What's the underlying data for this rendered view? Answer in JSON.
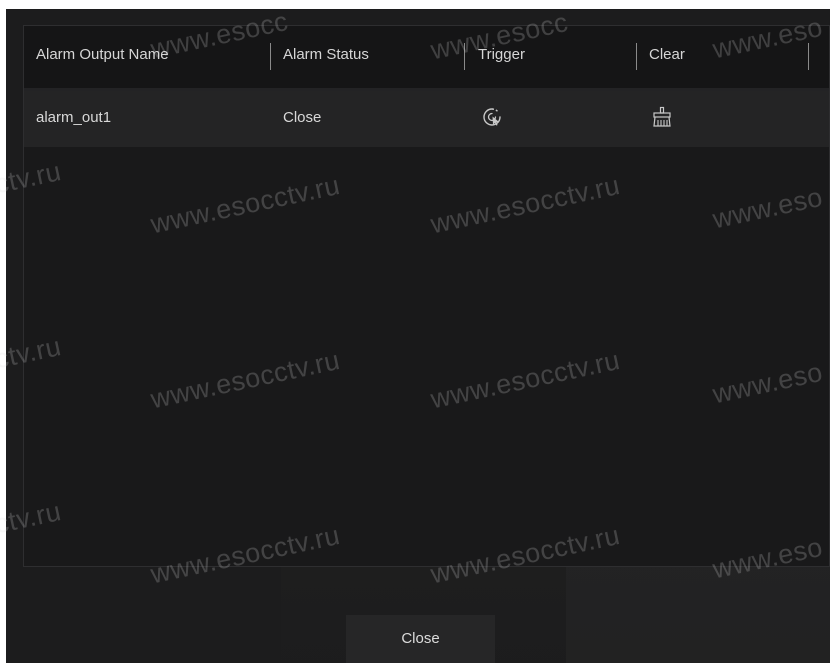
{
  "table": {
    "columns": [
      "Alarm Output Name",
      "Alarm Status",
      "Trigger",
      "Clear"
    ],
    "rows": [
      {
        "name": "alarm_out1",
        "status": "Close",
        "trigger_icon": "trigger-icon",
        "clear_icon": "broom-clear-icon"
      }
    ]
  },
  "footer": {
    "close_label": "Close"
  },
  "watermark": {
    "full": "www.esocctv.ru",
    "partial_left": "ctv.ru",
    "partial_right": "www.eso",
    "partial_top": "www.esocc",
    "color": "#dcdcdc"
  },
  "colors": {
    "dialog_bg": "#1c1c1d",
    "row_bg": "#242425",
    "text": "#d8d8d8"
  }
}
